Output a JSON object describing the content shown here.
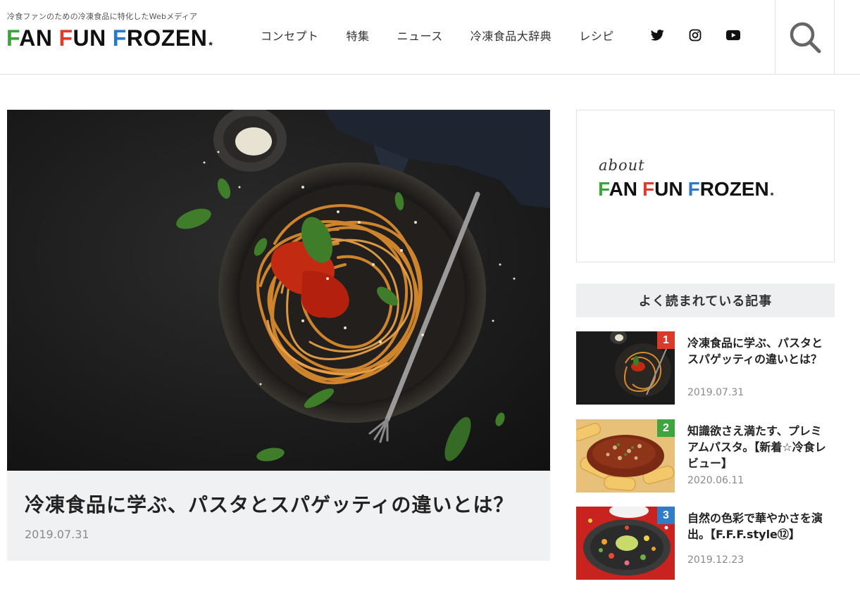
{
  "header": {
    "tagline": "冷食ファンのための冷凍食品に特化したWebメディア",
    "logo": {
      "w1_initial": "F",
      "w1_rest": "AN",
      "w2_initial": "F",
      "w2_rest": "UN",
      "w3_initial": "F",
      "w3_rest": "ROZEN",
      "star": "*"
    },
    "nav": [
      "コンセプト",
      "特集",
      "ニュース",
      "冷凍食品大辞典",
      "レシピ"
    ],
    "social": [
      "twitter-icon",
      "instagram-icon",
      "youtube-icon"
    ],
    "search_icon": "search-icon"
  },
  "colors": {
    "logo_green": "#3aa43a",
    "logo_red": "#e03a2b",
    "logo_blue": "#2a79c8",
    "caption_bg": "#f0f1f3",
    "rank1": "#d93a2b",
    "rank2": "#3fa43f",
    "rank3": "#2f7cc8"
  },
  "feature": {
    "title": "冷凍食品に学ぶ、パスタとスパゲッティの違いとは？",
    "date": "2019.07.31"
  },
  "sidebar": {
    "about_label": "about",
    "popular_heading": "よく読まれている記事",
    "ranking": [
      {
        "rank": "1",
        "title": "冷凍食品に学ぶ、パスタとスパゲッティの違いとは？",
        "date": "2019.07.31"
      },
      {
        "rank": "2",
        "title": "知識欲さえ満たす、プレミアムパスタ。【新着☆冷食レビュー】",
        "date": "2020.06.11"
      },
      {
        "rank": "3",
        "title": "自然の色彩で華やかさを演出。【F.F.F.style⑫】",
        "date": "2019.12.23"
      }
    ]
  }
}
